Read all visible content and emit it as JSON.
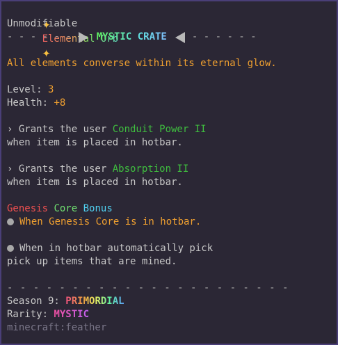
{
  "item": {
    "star": "✦",
    "name": "Elemental Orb",
    "modifier": "Unmodifiable",
    "crate_dashes_left": "- - - - - -",
    "crate_label": "MYSTIC CRATE",
    "crate_dashes_right": "- - - - - -",
    "lore": "All elements converse within its eternal glow.",
    "level_label": "Level: ",
    "level_value": "3",
    "health_label": "Health: ",
    "health_value": "+8",
    "ability1_prefix": "› Grants the user ",
    "ability1_name": "Conduit Power II",
    "ability1_suffix": "when item is placed in hotbar.",
    "ability2_prefix": "› Grants the user ",
    "ability2_name": "Absorption II",
    "ability2_suffix": "when item is placed in hotbar.",
    "bonus_word1": "Genesis",
    "bonus_word2": "Core",
    "bonus_word3": "Bonus",
    "bonus_line": "When Genesis Core is in hotbar.",
    "perk_line1": "When in hotbar automatically pick",
    "perk_line2": "pick up items that are mined.",
    "divider": "- - - - - - - - - - - - - - - - - - - - - -",
    "season_label": "Season 9: ",
    "season_value": "PRIMORDIAL",
    "rarity_label": "Rarity: ",
    "rarity_value": "MYSTIC",
    "item_id": "minecraft:feather"
  },
  "colors": {
    "background": "#2b2735",
    "border": "#4a3f78",
    "text_gray": "#c8c8c8",
    "orange": "#f0a030",
    "green": "#3fbf3f"
  }
}
